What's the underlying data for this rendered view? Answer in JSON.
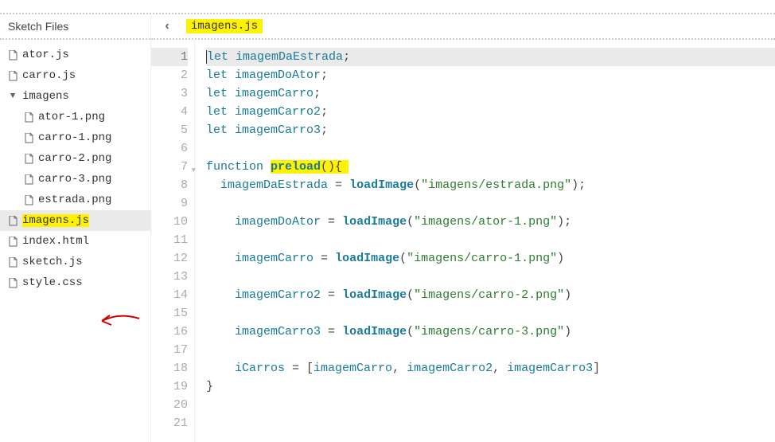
{
  "sidebar": {
    "title": "Sketch Files",
    "files": [
      {
        "name": "ator.js",
        "type": "file",
        "indent": 0
      },
      {
        "name": "carro.js",
        "type": "file",
        "indent": 0
      },
      {
        "name": "imagens",
        "type": "folder",
        "indent": 0
      },
      {
        "name": "ator-1.png",
        "type": "file",
        "indent": 1
      },
      {
        "name": "carro-1.png",
        "type": "file",
        "indent": 1
      },
      {
        "name": "carro-2.png",
        "type": "file",
        "indent": 1
      },
      {
        "name": "carro-3.png",
        "type": "file",
        "indent": 1
      },
      {
        "name": "estrada.png",
        "type": "file",
        "indent": 1
      },
      {
        "name": "imagens.js",
        "type": "file",
        "indent": 0,
        "selected": true,
        "highlight": true
      },
      {
        "name": "index.html",
        "type": "file",
        "indent": 0
      },
      {
        "name": "sketch.js",
        "type": "file",
        "indent": 0,
        "arrow": true
      },
      {
        "name": "style.css",
        "type": "file",
        "indent": 0
      }
    ]
  },
  "tab": {
    "current_file": "imagens.js"
  },
  "editor": {
    "lines": [
      {
        "n": 1,
        "active": true,
        "tokens": [
          {
            "t": "kw",
            "v": "let"
          },
          {
            "t": "plain",
            "v": " "
          },
          {
            "t": "ident",
            "v": "imagemDaEstrada"
          },
          {
            "t": "plain",
            "v": ";"
          }
        ],
        "cursor": true
      },
      {
        "n": 2,
        "tokens": [
          {
            "t": "kw",
            "v": "let"
          },
          {
            "t": "plain",
            "v": " "
          },
          {
            "t": "ident",
            "v": "imagemDoAtor"
          },
          {
            "t": "plain",
            "v": ";"
          }
        ]
      },
      {
        "n": 3,
        "tokens": [
          {
            "t": "kw",
            "v": "let"
          },
          {
            "t": "plain",
            "v": " "
          },
          {
            "t": "ident",
            "v": "imagemCarro"
          },
          {
            "t": "plain",
            "v": ";"
          }
        ]
      },
      {
        "n": 4,
        "tokens": [
          {
            "t": "kw",
            "v": "let"
          },
          {
            "t": "plain",
            "v": " "
          },
          {
            "t": "ident",
            "v": "imagemCarro2"
          },
          {
            "t": "plain",
            "v": ";"
          }
        ]
      },
      {
        "n": 5,
        "tokens": [
          {
            "t": "kw",
            "v": "let"
          },
          {
            "t": "plain",
            "v": " "
          },
          {
            "t": "ident",
            "v": "imagemCarro3"
          },
          {
            "t": "plain",
            "v": ";"
          }
        ]
      },
      {
        "n": 6,
        "tokens": []
      },
      {
        "n": 7,
        "fold": true,
        "tokens": [
          {
            "t": "fn-kw",
            "v": "function"
          },
          {
            "t": "plain",
            "v": " "
          },
          {
            "t": "fn-name",
            "v": "preload",
            "hl": true
          },
          {
            "t": "plain",
            "v": "(){",
            "hl": true,
            "hlpad": true
          }
        ]
      },
      {
        "n": 8,
        "tokens": [
          {
            "t": "plain",
            "v": "  "
          },
          {
            "t": "ident",
            "v": "imagemDaEstrada"
          },
          {
            "t": "plain",
            "v": " = "
          },
          {
            "t": "method",
            "v": "loadImage"
          },
          {
            "t": "plain",
            "v": "("
          },
          {
            "t": "str",
            "v": "\"imagens/estrada.png\""
          },
          {
            "t": "plain",
            "v": ");"
          }
        ]
      },
      {
        "n": 9,
        "tokens": []
      },
      {
        "n": 10,
        "tokens": [
          {
            "t": "plain",
            "v": "    "
          },
          {
            "t": "ident",
            "v": "imagemDoAtor"
          },
          {
            "t": "plain",
            "v": " = "
          },
          {
            "t": "method",
            "v": "loadImage"
          },
          {
            "t": "plain",
            "v": "("
          },
          {
            "t": "str",
            "v": "\"imagens/ator-1.png\""
          },
          {
            "t": "plain",
            "v": ");"
          }
        ]
      },
      {
        "n": 11,
        "tokens": []
      },
      {
        "n": 12,
        "tokens": [
          {
            "t": "plain",
            "v": "    "
          },
          {
            "t": "ident",
            "v": "imagemCarro"
          },
          {
            "t": "plain",
            "v": " = "
          },
          {
            "t": "method",
            "v": "loadImage"
          },
          {
            "t": "plain",
            "v": "("
          },
          {
            "t": "str",
            "v": "\"imagens/carro-1.png\""
          },
          {
            "t": "plain",
            "v": ")"
          }
        ]
      },
      {
        "n": 13,
        "tokens": []
      },
      {
        "n": 14,
        "tokens": [
          {
            "t": "plain",
            "v": "    "
          },
          {
            "t": "ident",
            "v": "imagemCarro2"
          },
          {
            "t": "plain",
            "v": " = "
          },
          {
            "t": "method",
            "v": "loadImage"
          },
          {
            "t": "plain",
            "v": "("
          },
          {
            "t": "str",
            "v": "\"imagens/carro-2.png\""
          },
          {
            "t": "plain",
            "v": ")"
          }
        ]
      },
      {
        "n": 15,
        "tokens": []
      },
      {
        "n": 16,
        "tokens": [
          {
            "t": "plain",
            "v": "    "
          },
          {
            "t": "ident",
            "v": "imagemCarro3"
          },
          {
            "t": "plain",
            "v": " = "
          },
          {
            "t": "method",
            "v": "loadImage"
          },
          {
            "t": "plain",
            "v": "("
          },
          {
            "t": "str",
            "v": "\"imagens/carro-3.png\""
          },
          {
            "t": "plain",
            "v": ")"
          }
        ]
      },
      {
        "n": 17,
        "tokens": []
      },
      {
        "n": 18,
        "tokens": [
          {
            "t": "plain",
            "v": "    "
          },
          {
            "t": "ident",
            "v": "iCarros"
          },
          {
            "t": "plain",
            "v": " = ["
          },
          {
            "t": "ident",
            "v": "imagemCarro"
          },
          {
            "t": "plain",
            "v": ", "
          },
          {
            "t": "ident",
            "v": "imagemCarro2"
          },
          {
            "t": "plain",
            "v": ", "
          },
          {
            "t": "ident",
            "v": "imagemCarro3"
          },
          {
            "t": "plain",
            "v": "]"
          }
        ]
      },
      {
        "n": 19,
        "tokens": [
          {
            "t": "plain",
            "v": "}"
          }
        ]
      },
      {
        "n": 20,
        "tokens": []
      },
      {
        "n": 21,
        "tokens": []
      }
    ]
  }
}
